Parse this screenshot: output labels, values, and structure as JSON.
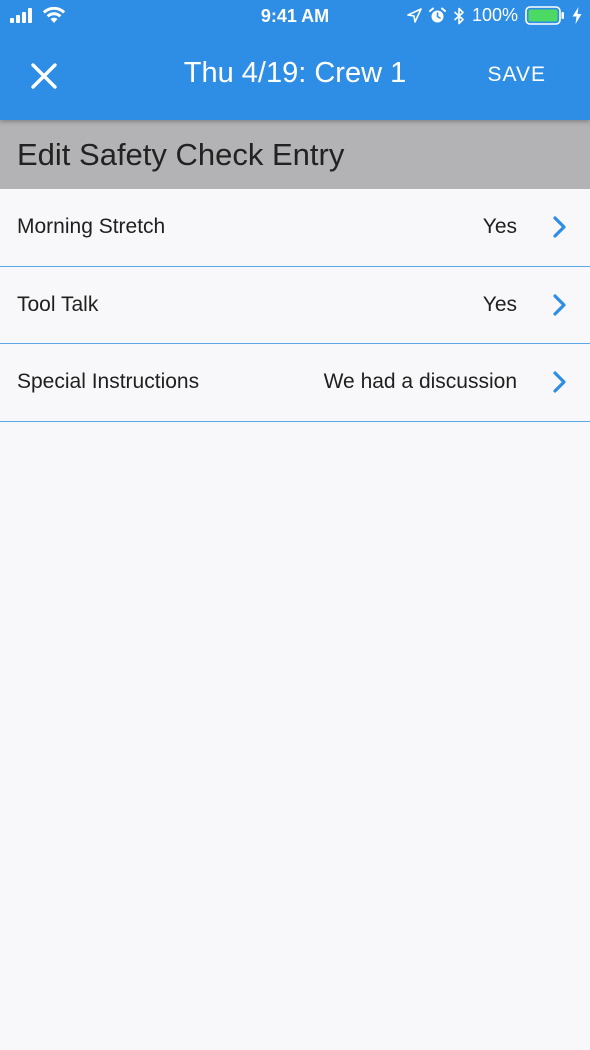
{
  "status_bar": {
    "time": "9:41 AM",
    "battery_percent": "100%",
    "icons": [
      "signal-icon",
      "wifi-icon",
      "location-icon",
      "alarm-icon",
      "bluetooth-icon",
      "battery-icon",
      "charging-icon"
    ]
  },
  "nav": {
    "title": "Thu 4/19: Crew 1",
    "save_label": "SAVE",
    "close_icon": "close-icon"
  },
  "section": {
    "title": "Edit Safety Check Entry"
  },
  "rows": [
    {
      "label": "Morning Stretch",
      "value": "Yes"
    },
    {
      "label": "Tool Talk",
      "value": "Yes"
    },
    {
      "label": "Special Instructions",
      "value": "We had a discussion"
    }
  ],
  "colors": {
    "header": "#2e8ee6",
    "section_bg": "#b3b3b5",
    "divider": "#5aa9e6",
    "chevron": "#2e8ee6",
    "battery_fill": "#4cd964"
  }
}
